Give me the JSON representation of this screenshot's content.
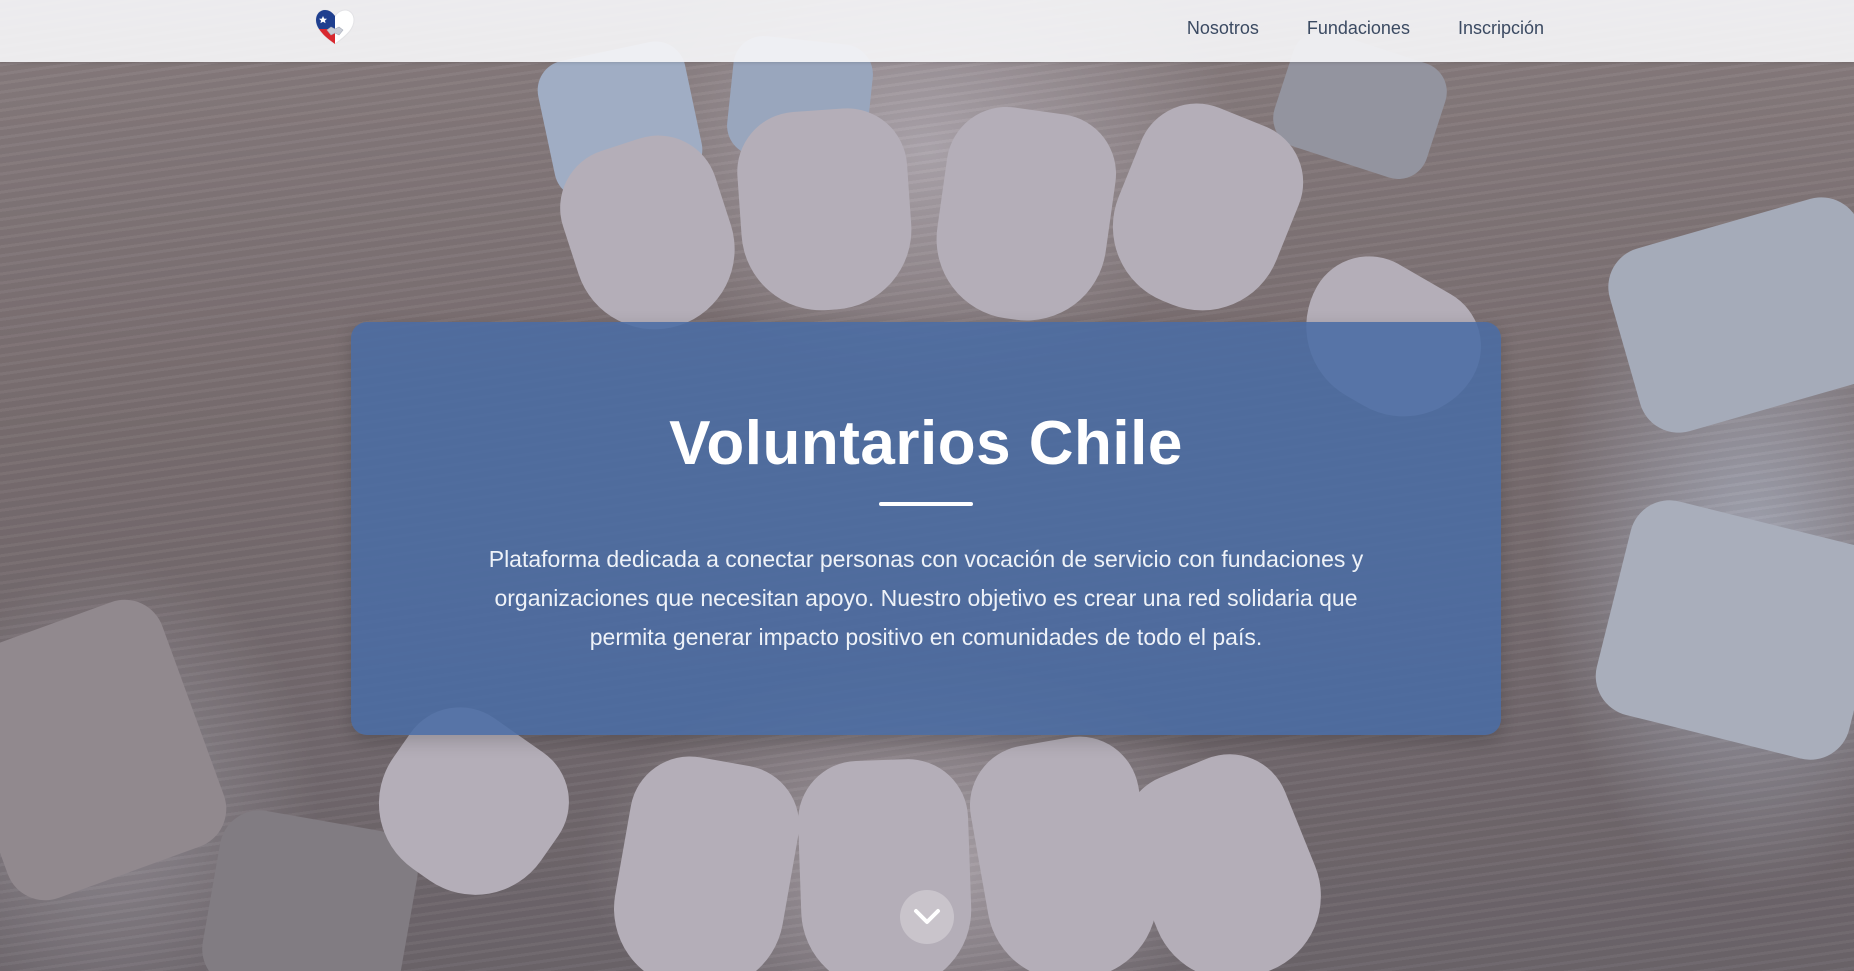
{
  "navbar": {
    "logo_icon": "chile-flag-heart-handshake-icon",
    "links": [
      {
        "label": "Nosotros"
      },
      {
        "label": "Fundaciones"
      },
      {
        "label": "Inscripción"
      }
    ]
  },
  "hero": {
    "title": "Voluntarios Chile",
    "description": "Plataforma dedicada a conectar personas con vocación de servicio con fundaciones y organizaciones que necesitan apoyo. Nuestro objetivo es crear una red solidaria que permita generar impacto positivo en comunidades de todo el país.",
    "scroll_icon": "chevron-down-icon"
  },
  "colors": {
    "nav_text": "#3b4a62",
    "card_background": "#4a6ca4",
    "hero_tint": "#5f78a8",
    "flag_blue": "#1f3f8f",
    "flag_red": "#d8282f"
  }
}
